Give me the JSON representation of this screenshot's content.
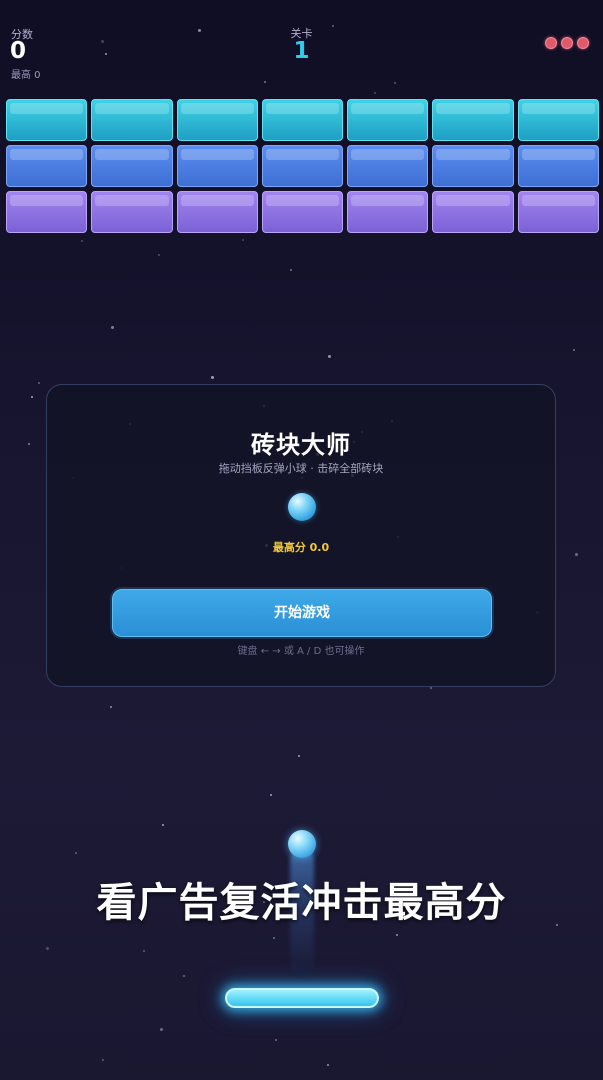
{
  "hud": {
    "score_label": "分数",
    "score": "0",
    "best_label": "最高 0",
    "level_label": "关卡",
    "level": "1",
    "lives": 3
  },
  "bricks": {
    "columns": 7,
    "rows": [
      {
        "color_top": "#3fd3e6",
        "color_bottom": "#1f9fc4",
        "border": "#5fe3f0"
      },
      {
        "color_top": "#5b8ef0",
        "color_bottom": "#3e6fd4",
        "border": "#7ea6f7"
      },
      {
        "color_top": "#a285f0",
        "color_bottom": "#7b61d6",
        "border": "#bba3f7"
      }
    ]
  },
  "modal": {
    "title": "砖块大师",
    "subtitle": "拖动挡板反弹小球 · 击碎全部砖块",
    "best_score": "最高分  0.0",
    "start_button": "开始游戏",
    "hint": "键盘 ← → 或 A / D 也可操作"
  },
  "banner": "看广告复活冲击最高分",
  "colors": {
    "accent": "#33c9e8",
    "life": "#e05a6e",
    "best_score": "#f2c83a",
    "button": "#2a8fd6"
  }
}
